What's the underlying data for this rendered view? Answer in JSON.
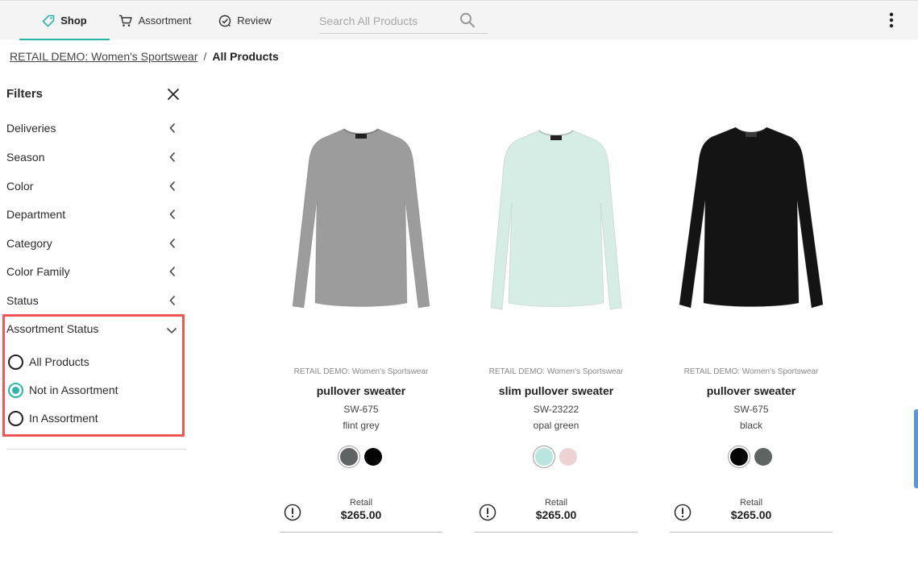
{
  "nav": {
    "tabs": [
      {
        "label": "Shop",
        "icon": "tag-icon",
        "active": true
      },
      {
        "label": "Assortment",
        "icon": "cart-icon",
        "active": false
      },
      {
        "label": "Review",
        "icon": "check-circle-icon",
        "active": false
      }
    ],
    "search_placeholder": "Search All Products",
    "menu_icon": "kebab-icon"
  },
  "breadcrumb": {
    "link": "RETAIL DEMO: Women's Sportswear",
    "separator": "/",
    "current": "All Products"
  },
  "filters": {
    "title": "Filters",
    "items": [
      "Deliveries",
      "Season",
      "Color",
      "Department",
      "Category",
      "Color Family",
      "Status"
    ],
    "expanded": {
      "label": "Assortment Status",
      "options": [
        {
          "label": "All Products",
          "checked": false
        },
        {
          "label": "Not in Assortment",
          "checked": true
        },
        {
          "label": "In Assortment",
          "checked": false
        }
      ]
    }
  },
  "products": [
    {
      "brand": "RETAIL DEMO: Women's Sportswear",
      "name": "pullover sweater",
      "sku": "SW-675",
      "color": "flint grey",
      "sweater_color": "#9c9c9c",
      "swatches": [
        "#5f6364",
        "#050505"
      ],
      "selected_swatch": 0,
      "retail_label": "Retail",
      "price": "$265.00"
    },
    {
      "brand": "RETAIL DEMO: Women's Sportswear",
      "name": "slim pullover sweater",
      "sku": "SW-23222",
      "color": "opal green",
      "sweater_color": "#d6ede5",
      "swatches": [
        "#b8e5de",
        "#ecd2d4"
      ],
      "selected_swatch": 0,
      "retail_label": "Retail",
      "price": "$265.00"
    },
    {
      "brand": "RETAIL DEMO: Women's Sportswear",
      "name": "pullover sweater",
      "sku": "SW-675",
      "color": "black",
      "sweater_color": "#141414",
      "swatches": [
        "#050505",
        "#5f6364"
      ],
      "selected_swatch": 0,
      "retail_label": "Retail",
      "price": "$265.00"
    }
  ],
  "colors": {
    "accent": "#2eb5a8",
    "highlight": "#ee5553"
  }
}
